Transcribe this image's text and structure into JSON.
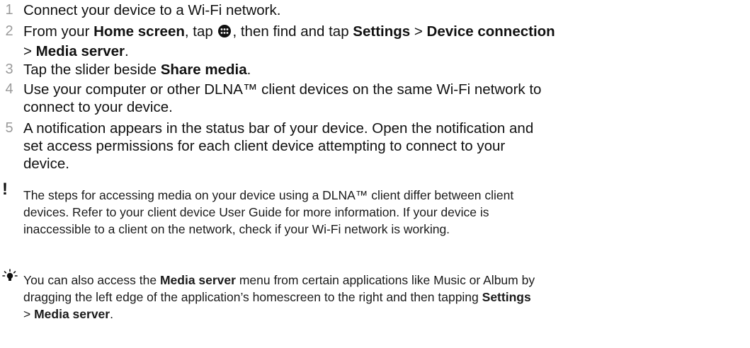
{
  "steps": [
    {
      "num": "1",
      "t1": "Connect your device to a Wi-Fi network."
    },
    {
      "num": "2",
      "t1": "From your ",
      "b1": "Home screen",
      "t2": ", tap ",
      "t3": ", then find and tap ",
      "b2": "Settings",
      "t4": " > ",
      "b3": "Device connection",
      "t5": "> ",
      "b4": "Media server",
      "t6": "."
    },
    {
      "num": "3",
      "t1": "Tap the slider beside ",
      "b1": "Share media",
      "t2": "."
    },
    {
      "num": "4",
      "line1": "Use your computer or other DLNA™ client devices on the same Wi-Fi network to",
      "line2": "connect to your device."
    },
    {
      "num": "5",
      "line1": "A notification appears in the status bar of your device. Open the notification and",
      "line2": "set access permissions for each client device attempting to connect to your",
      "line3": "device."
    }
  ],
  "note": {
    "icon": "exclamation-icon",
    "line1": "The steps for accessing media on your device using a DLNA™ client differ between client",
    "line2": "devices. Refer to your client device User Guide for more information. If your device is",
    "line3": "inaccessible to a client on the network, check if your Wi-Fi network is working."
  },
  "tip": {
    "icon": "lightbulb-icon",
    "t1": "You can also access the ",
    "b1": "Media server",
    "t2": " menu from certain applications like Music or Album by",
    "line2": "dragging the left edge of the application’s homescreen to the right and then tapping ",
    "b2": "Settings",
    "t3": "> ",
    "b3": "Media server",
    "t4": "."
  },
  "icons": {
    "apps": "apps-grid-icon"
  }
}
